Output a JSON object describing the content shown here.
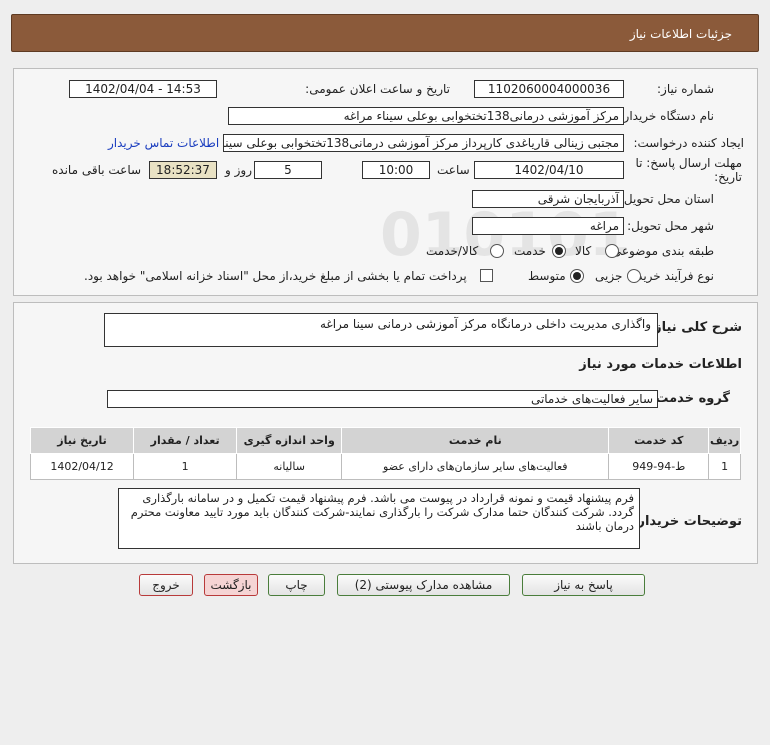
{
  "header": {
    "title": "جزئیات اطلاعات نیاز"
  },
  "fields": {
    "need_number_label": "شماره نیاز:",
    "need_number": "1102060004000036",
    "announce_label": "تاریخ و ساعت اعلان عمومی:",
    "announce_value": "1402/04/04 - 14:53",
    "buyer_org_label": "نام دستگاه خریدار:",
    "buyer_org": "مرکز آموزشی درمانی138تختخوابی بوعلی سیناء مراغه",
    "requester_label": "ایجاد کننده درخواست:",
    "requester": "مجتبی زینالی قاریاغدی کارپرداز مرکز آموزشی درمانی138تختخوابی بوعلی سینا",
    "contact_link": "اطلاعات تماس خریدار",
    "deadline_label": "مهلت ارسال پاسخ: تا تاریخ:",
    "deadline_date": "1402/04/10",
    "time_label": "ساعت",
    "deadline_time": "10:00",
    "days_value": "5",
    "days_label": "روز و",
    "remaining_time": "18:52:37",
    "remaining_label": "ساعت باقی مانده",
    "province_label": "استان محل تحویل:",
    "province": "آذربایجان شرقی",
    "city_label": "شهر محل تحویل:",
    "city": "مراغه",
    "category_label": "طبقه بندی موضوعی:",
    "category_options": [
      "کالا",
      "خدمت",
      "کالا/خدمت"
    ],
    "category_selected": "خدمت",
    "process_label": "نوع فرآیند خرید :",
    "process_options": [
      "جزیی",
      "متوسط"
    ],
    "process_selected": "متوسط",
    "payment_note": "پرداخت تمام یا بخشی از مبلغ خرید،از محل \"اسناد خزانه اسلامی\" خواهد بود."
  },
  "summary": {
    "label": "شرح کلی نیاز:",
    "value": "واگذاری مدیریت داخلی درمانگاه مرکز آموزشی درمانی سینا مراغه",
    "services_title": "اطلاعات خدمات مورد نیاز",
    "group_label": "گروه خدمت:",
    "group_value": "سایر فعالیت‌های خدماتی"
  },
  "table": {
    "headers": [
      "ردیف",
      "کد خدمت",
      "نام خدمت",
      "واحد اندازه گیری",
      "تعداد / مقدار",
      "تاریخ نیاز"
    ],
    "rows": [
      [
        "1",
        "ط-94-949",
        "فعالیت‌های سایر سازمان‌های دارای عضو",
        "سالیانه",
        "1",
        "1402/04/12"
      ]
    ]
  },
  "notes": {
    "label": "توضیحات خریدار:",
    "value": "فرم پیشنهاد قیمت و نمونه قرارداد در پیوست می باشد. فرم پیشنهاد قیمت تکمیل و در سامانه بارگذاری گردد. شرکت کنندگان حتما مدارک شرکت را بارگذاری نمایند-شرکت کنندگان باید مورد تایید معاونت محترم درمان باشند"
  },
  "buttons": {
    "reply": "پاسخ به نیاز",
    "attachments": "مشاهده مدارک پیوستی (2)",
    "print": "چاپ",
    "back": "بازگشت",
    "exit": "خروج"
  },
  "watermark": {
    "brand": "ParsNamadData",
    "phone": "۰۲۱-۸۸۳۴۹۶۷۰"
  }
}
